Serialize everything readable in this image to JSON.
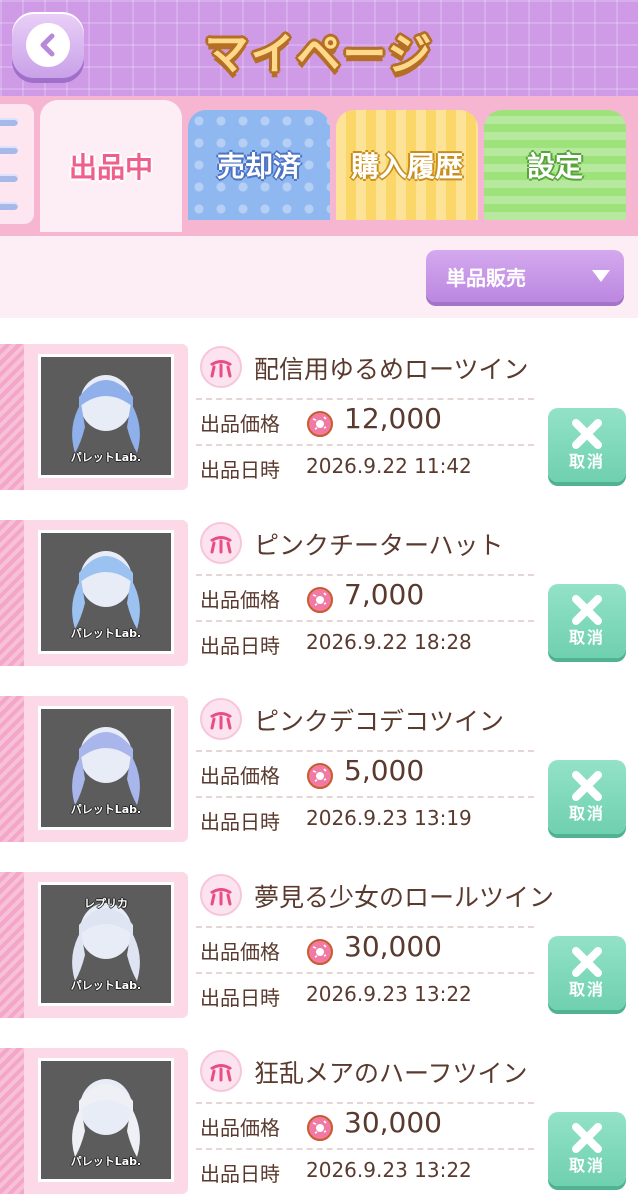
{
  "header": {
    "title": "マイページ",
    "back_icon": "chevron-left-icon"
  },
  "tabs": [
    {
      "label": "出品中",
      "active": true
    },
    {
      "label": "売却済",
      "active": false
    },
    {
      "label": "購入履歴",
      "active": false
    },
    {
      "label": "設定",
      "active": false
    }
  ],
  "filter": {
    "selected": "単品販売"
  },
  "labels": {
    "price": "出品価格",
    "date": "出品日時",
    "cancel": "取消"
  },
  "currency_icon": "donut-icon",
  "items": [
    {
      "name": "配信用ゆるめローツイン",
      "price": "12,000",
      "date": "2026.9.22 11:42",
      "thumb_brand": "パレットLab.",
      "thumb_top": ""
    },
    {
      "name": "ピンクチーターハット",
      "price": "7,000",
      "date": "2026.9.22 18:28",
      "thumb_brand": "パレットLab.",
      "thumb_top": ""
    },
    {
      "name": "ピンクデコデコツイン",
      "price": "5,000",
      "date": "2026.9.23 13:19",
      "thumb_brand": "パレットLab.",
      "thumb_top": ""
    },
    {
      "name": "夢見る少女のロールツイン",
      "price": "30,000",
      "date": "2026.9.23 13:22",
      "thumb_brand": "パレットLab.",
      "thumb_top": "レプリカ"
    },
    {
      "name": "狂乱メアのハーフツイン",
      "price": "30,000",
      "date": "2026.9.23 13:22",
      "thumb_brand": "パレットLab.",
      "thumb_top": ""
    }
  ],
  "colors": {
    "header": "#cf9be6",
    "accent_pink": "#ee5f8c",
    "cancel_green": "#6fd0b0"
  }
}
